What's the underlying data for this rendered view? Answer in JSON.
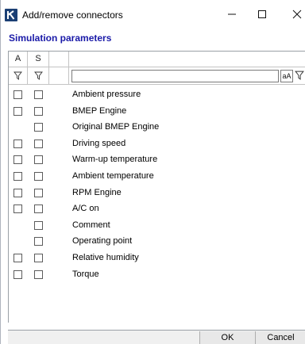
{
  "window": {
    "title": "Add/remove connectors",
    "logo_letter": "K"
  },
  "section": {
    "title": "Simulation parameters"
  },
  "grid": {
    "columns": [
      "A",
      "S",
      ""
    ],
    "filter": {
      "value": "",
      "case_label": "aA"
    },
    "rows": [
      {
        "label": "Ambient pressure",
        "a": true,
        "s": true
      },
      {
        "label": "BMEP Engine",
        "a": true,
        "s": true
      },
      {
        "label": "Original BMEP Engine",
        "a": false,
        "s": true
      },
      {
        "label": "Driving speed",
        "a": true,
        "s": true
      },
      {
        "label": "Warm-up temperature",
        "a": true,
        "s": true
      },
      {
        "label": "Ambient temperature",
        "a": true,
        "s": true
      },
      {
        "label": "RPM Engine",
        "a": true,
        "s": true
      },
      {
        "label": "A/C on",
        "a": true,
        "s": true
      },
      {
        "label": "Comment",
        "a": false,
        "s": true
      },
      {
        "label": "Operating point",
        "a": false,
        "s": true
      },
      {
        "label": "Relative humidity",
        "a": true,
        "s": true
      },
      {
        "label": "Torque",
        "a": true,
        "s": true
      }
    ]
  },
  "buttons": {
    "ok": "OK",
    "cancel": "Cancel"
  },
  "colors": {
    "accent": "#1a1aa8",
    "logo": "#1b3f74"
  },
  "icons": {
    "filter": "filter-icon",
    "minimize": "minimize-icon",
    "maximize": "maximize-icon",
    "close": "close-icon"
  }
}
